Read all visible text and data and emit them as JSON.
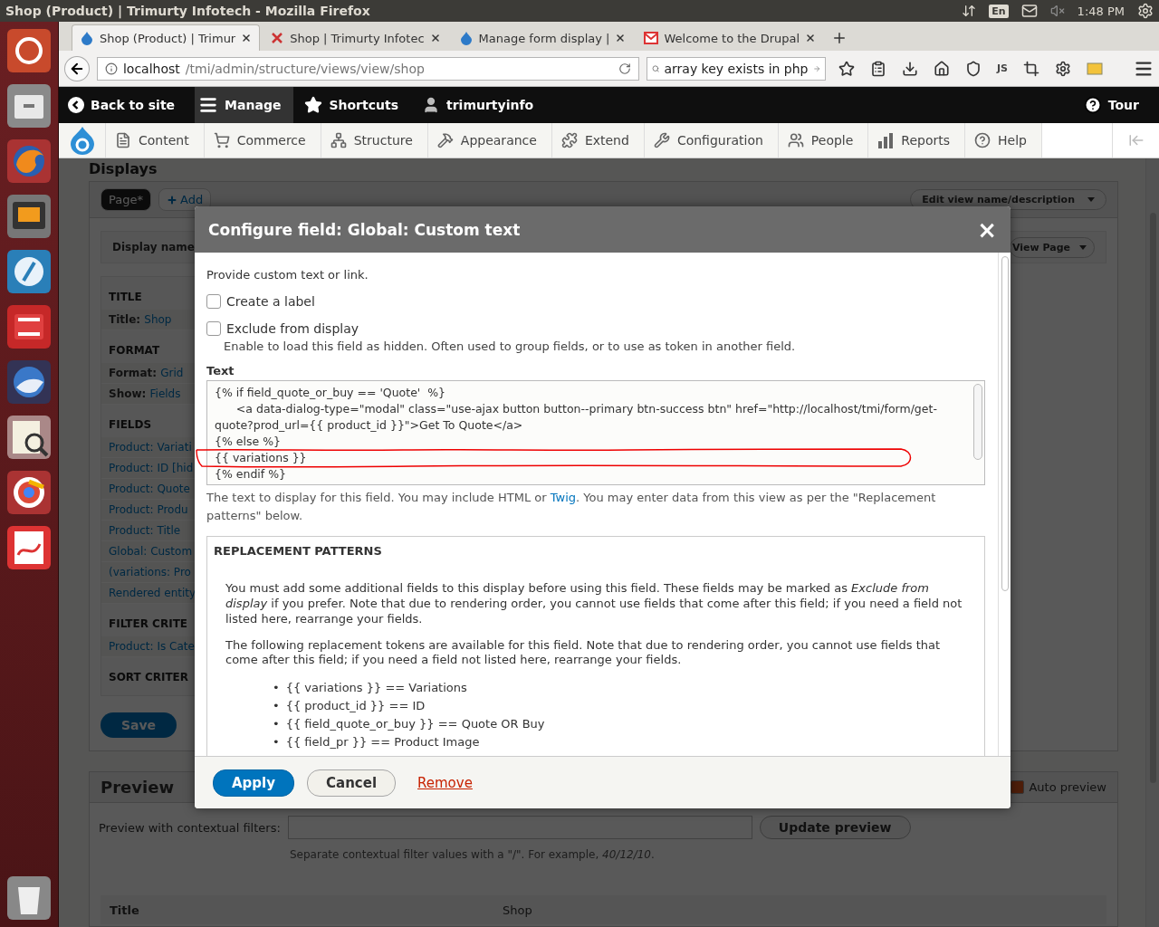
{
  "window": {
    "title": "Shop (Product) | Trimurty Infotech - Mozilla Firefox"
  },
  "system_tray": {
    "keyboard": "En",
    "time": "1:48 PM"
  },
  "tabs": [
    {
      "title": "Shop (Product) | Trimur",
      "kind": "drupal",
      "selected": true
    },
    {
      "title": "Shop | Trimurty Infotec",
      "kind": "shop",
      "selected": false
    },
    {
      "title": "Manage form display |",
      "kind": "drupal",
      "selected": false
    },
    {
      "title": "Welcome to the Drupal",
      "kind": "mail",
      "selected": false
    }
  ],
  "address": {
    "host": "localhost",
    "path": "/tmi/admin/structure/views/view/shop"
  },
  "search": "array key exists in php",
  "nav_text": "JS",
  "toolbar": {
    "items": [
      {
        "label": "Back to site",
        "kind": "back",
        "selected": false
      },
      {
        "label": "Manage",
        "kind": "manage",
        "selected": true
      },
      {
        "label": "Shortcuts",
        "kind": "star",
        "selected": false
      },
      {
        "label": "trimurtyinfo",
        "kind": "user",
        "selected": false
      }
    ],
    "tour": "Tour"
  },
  "tray": [
    {
      "label": "Content",
      "kind": "content"
    },
    {
      "label": "Commerce",
      "kind": "commerce"
    },
    {
      "label": "Structure",
      "kind": "structure"
    },
    {
      "label": "Appearance",
      "kind": "appearance"
    },
    {
      "label": "Extend",
      "kind": "extend"
    },
    {
      "label": "Configuration",
      "kind": "configuration"
    },
    {
      "label": "People",
      "kind": "people"
    },
    {
      "label": "Reports",
      "kind": "reports"
    },
    {
      "label": "Help",
      "kind": "help"
    }
  ],
  "page": {
    "title": "Displays",
    "display_tabs": [
      {
        "label": "Page*",
        "selected": true
      },
      {
        "label": "Add",
        "selected": false
      }
    ],
    "edit_button": "Edit view name/description",
    "display_name": "Display name",
    "view_page_button": "View Page",
    "sections": [
      {
        "title": "TITLE",
        "rows": [
          {
            "label": "Title:",
            "value": "Shop"
          }
        ]
      },
      {
        "title": "FORMAT",
        "rows": [
          {
            "label": "Format:",
            "value": "Grid"
          },
          {
            "label": "Show:",
            "value": "Fields"
          }
        ]
      },
      {
        "title": "FIELDS",
        "rows": [
          {
            "value": "Product: Variati"
          },
          {
            "value": "Product: ID [hid"
          },
          {
            "value": "Product: Quote"
          },
          {
            "value": "Product: Produ"
          },
          {
            "value": "Product: Title"
          },
          {
            "value": "Global: Custom"
          },
          {
            "value": "(variations: Pro"
          },
          {
            "value": "Rendered entity"
          }
        ]
      },
      {
        "title": "FILTER CRITE",
        "rows": [
          {
            "value": "Product: Is Cate"
          }
        ]
      },
      {
        "title": "SORT CRITER"
      }
    ],
    "save": "Save",
    "preview": {
      "title": "Preview",
      "auto_preview": {
        "label": "Auto preview",
        "checked": true
      },
      "filter_label": "Preview with contextual filters:",
      "update_button": "Update preview",
      "hint": "Separate contextual filter values with a \"/\". For example, *40/12/10*.",
      "table": [
        {
          "label": "Title",
          "value": "Shop"
        }
      ]
    }
  },
  "dialog": {
    "title": "Configure field: Global: Custom text",
    "close": "×",
    "intro": "Provide custom text or link.",
    "checkboxes": [
      {
        "label": "Create a label",
        "checked": false
      },
      {
        "label": "Exclude from display",
        "checked": false,
        "description": "Enable to load this field as hidden. Often used to group fields, or to use as token in another field."
      }
    ],
    "text_label": "Text",
    "text_value": "{% if field_quote_or_buy == 'Quote'  %}\n      <a data-dialog-type=\"modal\" class=\"use-ajax button button--primary btn-success btn\" href=\"http://localhost/tmi/form/get-quote?prod_url={{ product_id }}\">Get To Quote</a>\n{% else %}\n{{ variations }}\n{% endif %}",
    "help_before": "The text to display for this field. You may include HTML or ",
    "help_link": "Twig",
    "help_after": ". You may enter data from this view as per the \"Replacement patterns\" below.",
    "patterns": {
      "title": "REPLACEMENT PATTERNS",
      "paragraphs": [
        "You must add some additional fields to this display before using this field. These fields may be marked as *Exclude from display* if you prefer. Note that due to rendering order, you cannot use fields that come after this field; if you need a field not listed here, rearrange your fields.",
        "The following replacement tokens are available for this field. Note that due to rendering order, you cannot use fields that come after this field; if you need a field not listed here, rearrange your fields."
      ],
      "bullet": "•",
      "tokens": [
        "{{ variations }} == Variations",
        "{{ product_id }} == ID",
        "{{ field_quote_or_buy }} == Quote OR Buy",
        "{{ field_pr }} == Product Image"
      ]
    },
    "buttons": [
      {
        "label": "Apply",
        "kind": "primary"
      },
      {
        "label": "Cancel",
        "kind": "secondary"
      },
      {
        "label": "Remove",
        "kind": "link"
      }
    ]
  }
}
